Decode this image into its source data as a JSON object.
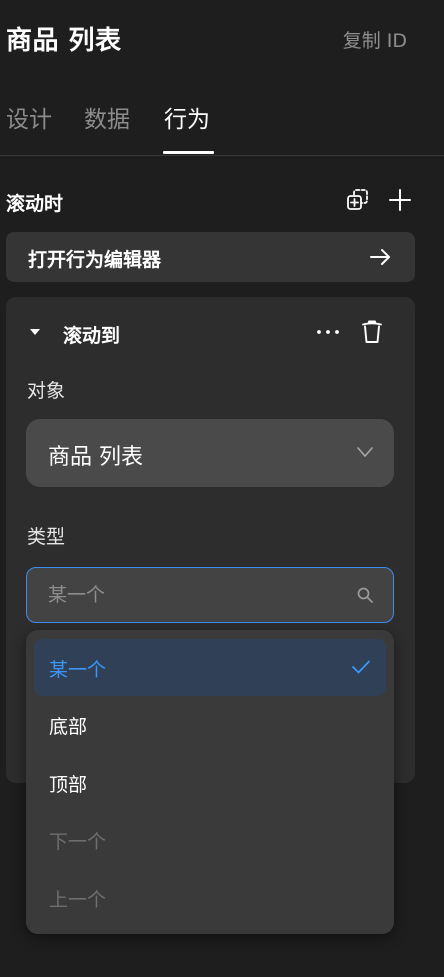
{
  "header": {
    "title": "商品 列表",
    "copy_id": "复制 ID"
  },
  "tabs": [
    {
      "label": "设计",
      "active": false
    },
    {
      "label": "数据",
      "active": false
    },
    {
      "label": "行为",
      "active": true
    }
  ],
  "section": {
    "title": "滚动时",
    "icons": [
      "copy-add-icon",
      "plus-icon"
    ]
  },
  "editor_bar": {
    "label": "打开行为编辑器",
    "icon": "arrow-right-icon"
  },
  "action_card": {
    "title": "滚动到",
    "object_label": "对象",
    "object_value": "商品 列表",
    "type_label": "类型",
    "search_placeholder": "某一个"
  },
  "dropdown": {
    "options": [
      {
        "label": "某一个",
        "selected": true,
        "disabled": false
      },
      {
        "label": "底部",
        "selected": false,
        "disabled": false
      },
      {
        "label": "顶部",
        "selected": false,
        "disabled": false
      },
      {
        "label": "下一个",
        "selected": false,
        "disabled": true
      },
      {
        "label": "上一个",
        "selected": false,
        "disabled": true
      }
    ]
  },
  "colors": {
    "background": "#1e1e1e",
    "panel": "#2d2d2d",
    "accent": "#3c8ef0",
    "selected_bg": "#2f4057",
    "selected_text": "#3d96f5",
    "disabled_text": "#6e6e6e"
  }
}
